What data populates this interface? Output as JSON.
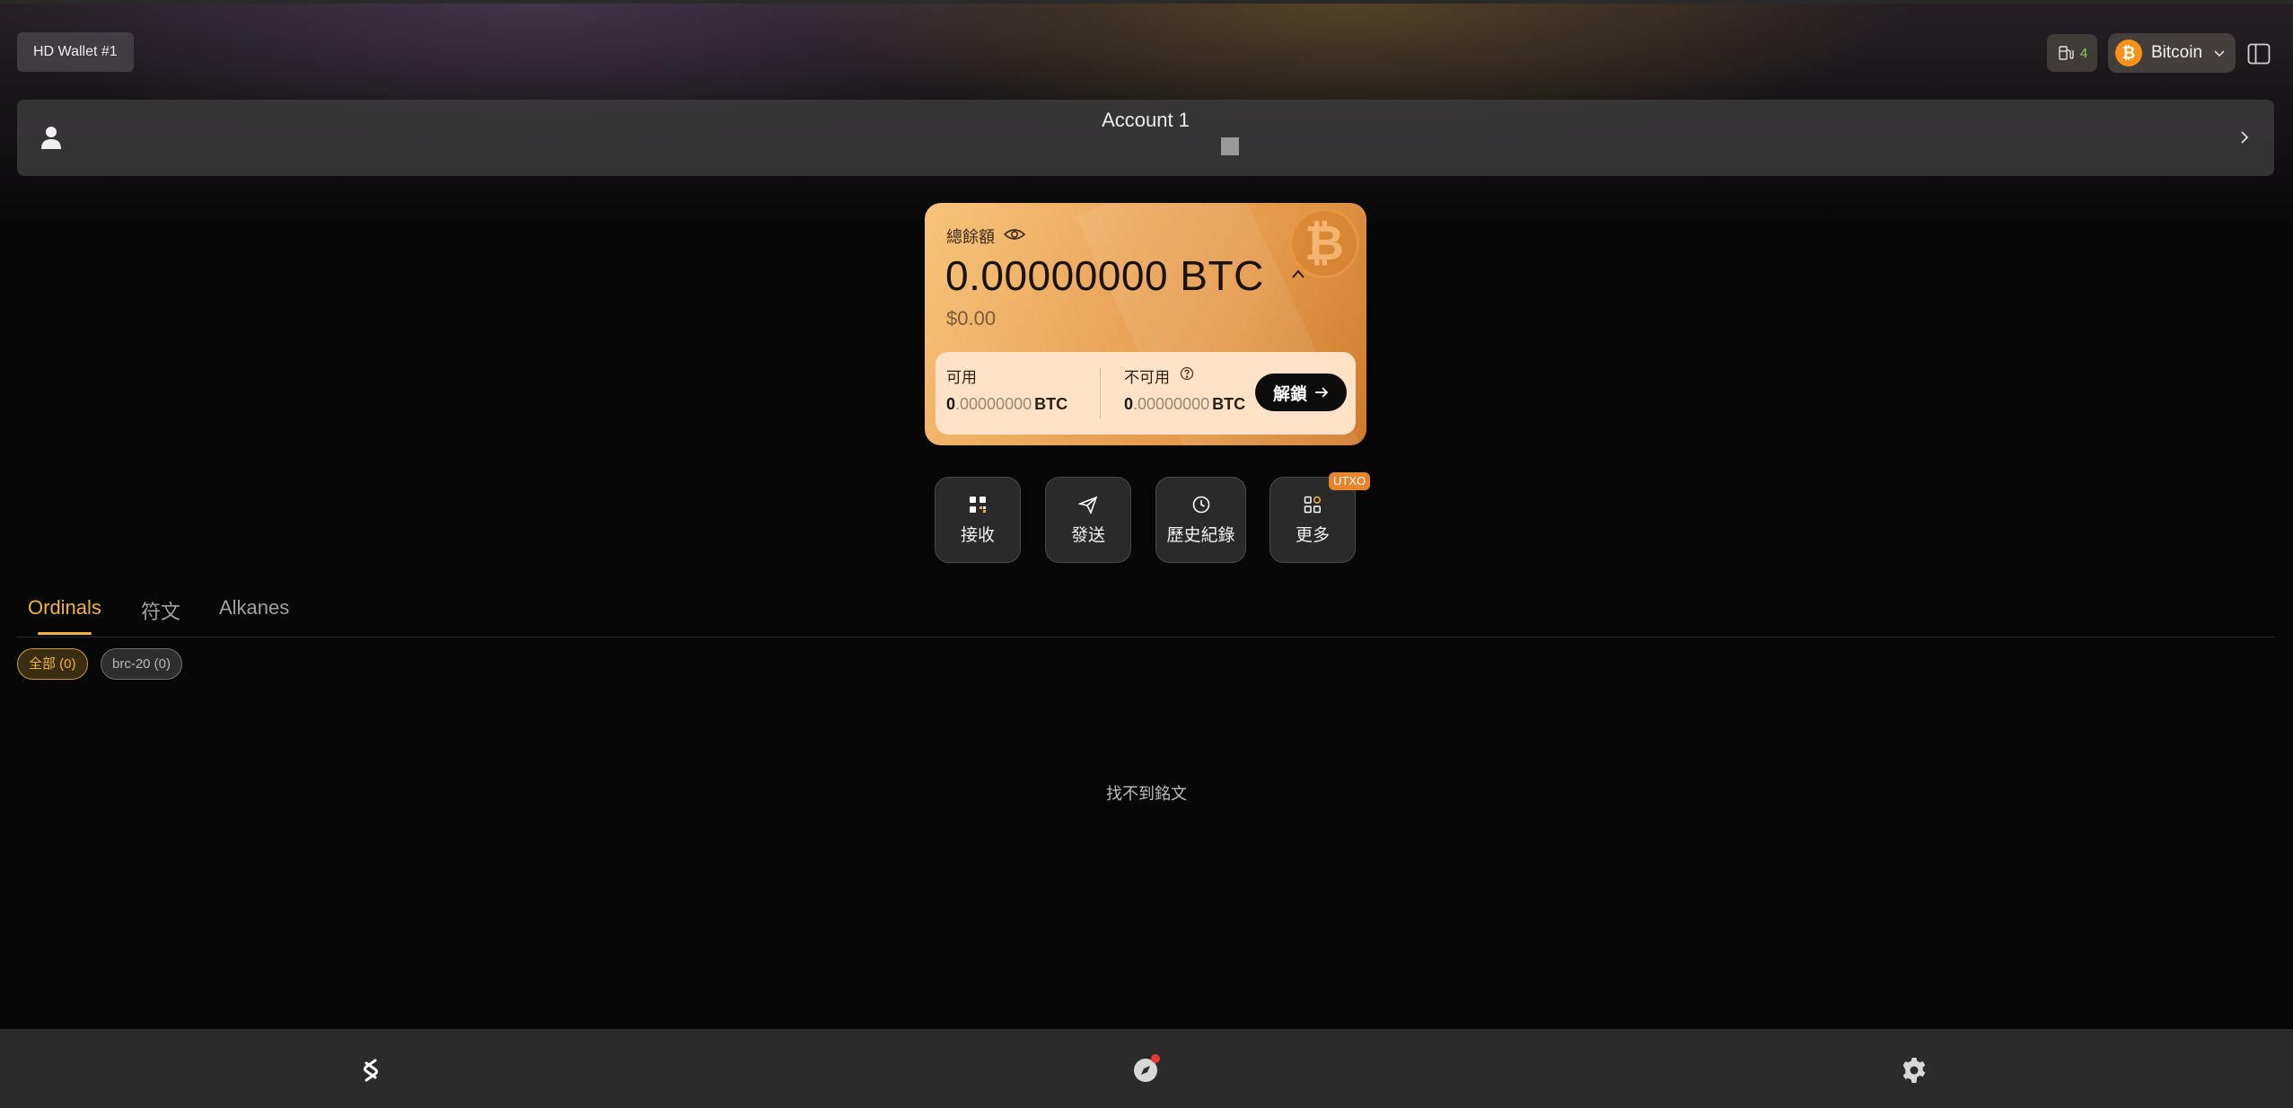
{
  "header": {
    "wallet_name": "HD Wallet #1",
    "gas_count": "4",
    "network": "Bitcoin",
    "accent_color": "#f7931a"
  },
  "account": {
    "name": "Account 1"
  },
  "balance": {
    "total_label": "總餘額",
    "total_amount": "0.00000000 BTC",
    "usd_value": "$0.00",
    "available_label": "可用",
    "available_int": "0",
    "available_dec": ".00000000",
    "available_unit": "BTC",
    "unavailable_label": "不可用",
    "unavailable_int": "0",
    "unavailable_dec": ".00000000",
    "unavailable_unit": "BTC",
    "unlock_label": "解鎖",
    "card_gradient": [
      "#f6c47a",
      "#cf7a2c"
    ]
  },
  "actions": {
    "receive": "接收",
    "send": "發送",
    "history": "歷史紀錄",
    "more": "更多",
    "more_badge": "UTXO"
  },
  "tabs": [
    {
      "label": "Ordinals",
      "active": true
    },
    {
      "label": "符文",
      "active": false
    },
    {
      "label": "Alkanes",
      "active": false
    }
  ],
  "filters": {
    "all": "全部 (0)",
    "brc20": "brc-20 (0)"
  },
  "empty_message": "找不到銘文",
  "colors": {
    "active_tab": "#f0b43c",
    "background": "#070707",
    "bottom_nav": "#2b2b2b",
    "gas_count": "#7ed957"
  },
  "bottom_nav": {
    "items": [
      "wallet-icon",
      "explore-icon",
      "settings-icon"
    ]
  }
}
